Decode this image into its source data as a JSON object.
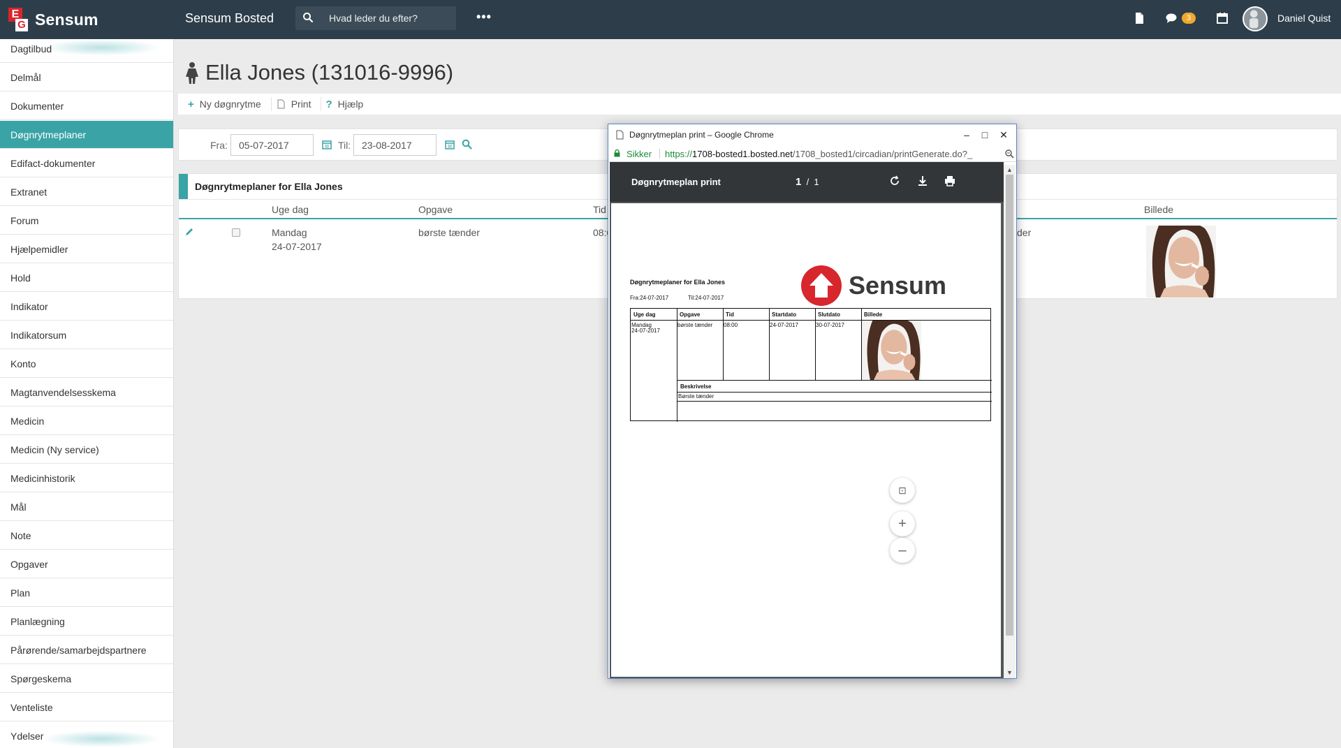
{
  "topbar": {
    "logo_text": "Sensum",
    "logo_letters": [
      "E",
      "G"
    ],
    "app_name": "Sensum Bosted",
    "search_placeholder": "Hvad leder du efter?",
    "more_label": "•••",
    "messages_badge": "3",
    "user_name": "Daniel Quist",
    "icons": [
      "document-icon",
      "chat-icon",
      "calendar-icon",
      "avatar"
    ],
    "colors": {
      "bar": "#2d3e4a",
      "badge": "#f0a92d"
    }
  },
  "sidebar": {
    "active_color": "#3aa3a6",
    "items": [
      {
        "label": "Dagtilbud",
        "active": false
      },
      {
        "label": "Delmål",
        "active": false
      },
      {
        "label": "Dokumenter",
        "active": false
      },
      {
        "label": "Døgnrytmeplaner",
        "active": true
      },
      {
        "label": "Edifact-dokumenter",
        "active": false
      },
      {
        "label": "Extranet",
        "active": false
      },
      {
        "label": "Forum",
        "active": false
      },
      {
        "label": "Hjælpemidler",
        "active": false
      },
      {
        "label": "Hold",
        "active": false
      },
      {
        "label": "Indikator",
        "active": false
      },
      {
        "label": "Indikatorsum",
        "active": false
      },
      {
        "label": "Konto",
        "active": false
      },
      {
        "label": "Magtanvendelsesskema",
        "active": false
      },
      {
        "label": "Medicin",
        "active": false
      },
      {
        "label": "Medicin (Ny service)",
        "active": false
      },
      {
        "label": "Medicinhistorik",
        "active": false
      },
      {
        "label": "Mål",
        "active": false
      },
      {
        "label": "Note",
        "active": false
      },
      {
        "label": "Opgaver",
        "active": false
      },
      {
        "label": "Plan",
        "active": false
      },
      {
        "label": "Planlægning",
        "active": false
      },
      {
        "label": "Pårørende/samarbejdspartnere",
        "active": false
      },
      {
        "label": "Spørgeskema",
        "active": false
      },
      {
        "label": "Venteliste",
        "active": false
      },
      {
        "label": "Ydelser",
        "active": false
      }
    ]
  },
  "page": {
    "title": "Ella Jones (131016-9996)",
    "toolbar": {
      "new_label": "Ny døgnrytme",
      "print_label": "Print",
      "help_label": "Hjælp"
    },
    "filter": {
      "from_label": "Fra:",
      "from_value": "05-07-2017",
      "to_label": "Til:",
      "to_value": "23-08-2017"
    },
    "list": {
      "heading": "Døgnrytmeplaner for  Ella Jones",
      "columns": [
        "Uge dag",
        "Opgave",
        "Tid",
        "Billede"
      ],
      "row": {
        "weekday": "Mandag",
        "date": "24-07-2017",
        "task": "børste tænder",
        "time_partial": "08:0",
        "description_partial": "der"
      }
    }
  },
  "popup": {
    "window_title": "Døgnrytmeplan print – Google Chrome",
    "secure_label": "Sikker",
    "url_scheme": "https://",
    "url_host": "1708-bosted1.bosted.net",
    "url_path": "/1708_bosted1/circadian/printGenerate.do?_",
    "pdf_title": "Døgnrytmeplan print",
    "page_current": "1",
    "page_total": "1",
    "pdf": {
      "heading": "Døgnrytmeplaner for Ella Jones",
      "from": "Fra:24-07-2017",
      "to": "Til:24-07-2017",
      "logo_text": "Sensum",
      "columns": [
        "Uge dag",
        "Opgave",
        "Tid",
        "Startdato",
        "Slutdato",
        "Billede"
      ],
      "row": {
        "weekday": "Mandag",
        "date": "24-07-2017",
        "task": "børste tænder",
        "time": "08:00",
        "start": "24-07-2017",
        "end": "30-07-2017"
      },
      "description_label": "Beskrivelse",
      "description_value": "Børste tænder"
    }
  }
}
